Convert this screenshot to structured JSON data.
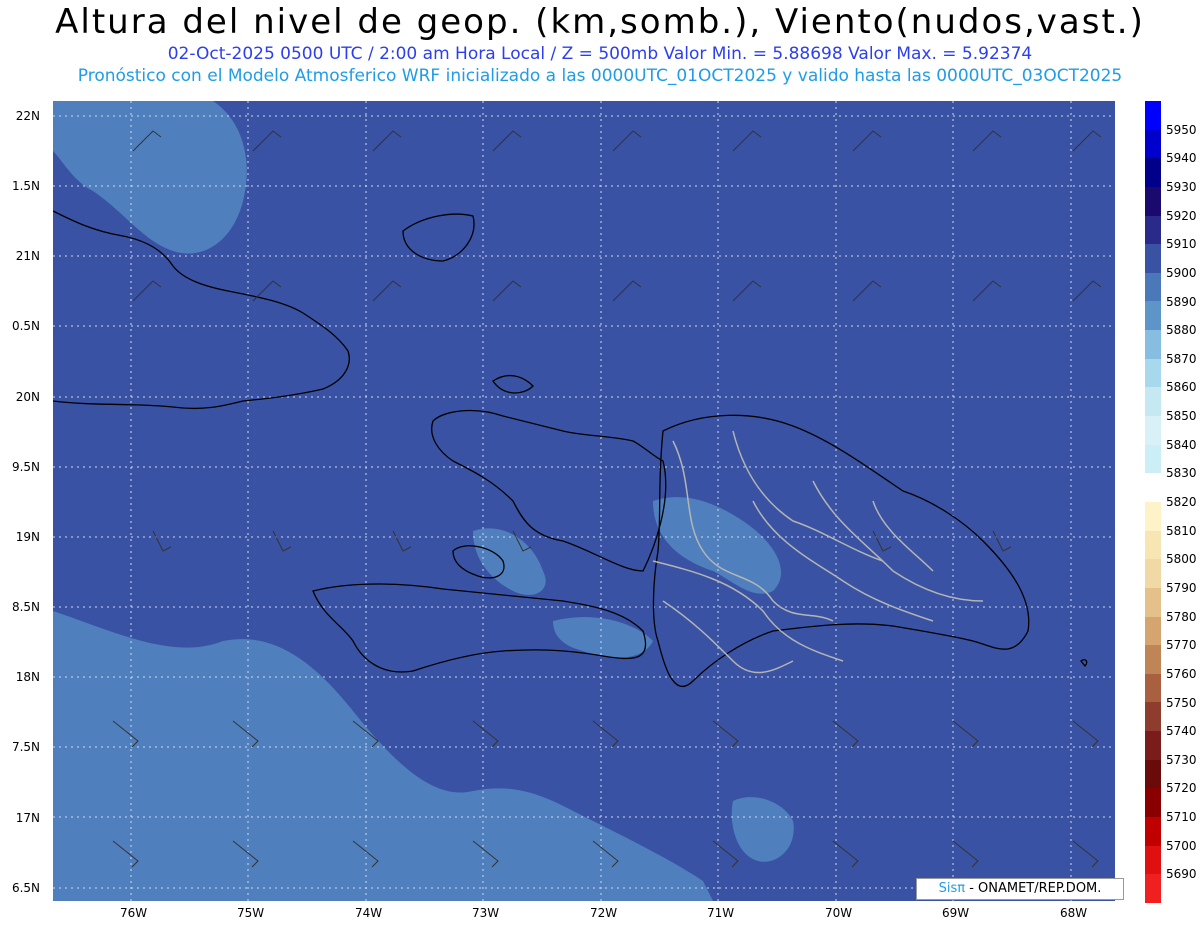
{
  "header": {
    "title": "Altura del nivel de geop. (km,somb.), Viento(nudos,vast.)",
    "subtitle": "02-Oct-2025   0500 UTC / 2:00 am Hora Local / Z = 500mb      Valor Min. = 5.88698   Valor Max. = 5.92374",
    "model_line": "Pronóstico con el Modelo Atmosferico WRF inicializado a las 0000UTC_01OCT2025 y valido hasta las  0000UTC_03OCT2025"
  },
  "axes": {
    "lat_labels": [
      "22N",
      "1.5N",
      "21N",
      "0.5N",
      "20N",
      "9.5N",
      "19N",
      "8.5N",
      "18N",
      "7.5N",
      "17N",
      "6.5N"
    ],
    "lon_labels": [
      "76W",
      "75W",
      "74W",
      "73W",
      "72W",
      "71W",
      "70W",
      "69W",
      "68W"
    ]
  },
  "colorbar": {
    "labels": [
      "5950",
      "5940",
      "5930",
      "5920",
      "5910",
      "5900",
      "5890",
      "5880",
      "5870",
      "5860",
      "5850",
      "5840",
      "5830",
      "5820",
      "5810",
      "5800",
      "5790",
      "5780",
      "5770",
      "5760",
      "5750",
      "5740",
      "5730",
      "5720",
      "5710",
      "5700",
      "5690"
    ],
    "colors": [
      "#0000ff",
      "#0000cc",
      "#00008b",
      "#1a0a6e",
      "#2a2a8a",
      "#3a52a4",
      "#4a78b8",
      "#5d95c8",
      "#86bde0",
      "#a8d8ec",
      "#c5e8f2",
      "#d8f0f6",
      "#cceff7",
      "#ffffff",
      "#fdf2c8",
      "#f7e6b4",
      "#f0d9a4",
      "#e4c08a",
      "#d4a56f",
      "#c08556",
      "#a86040",
      "#8e3c2e",
      "#7a1c1c",
      "#6a0a0a",
      "#8a0000",
      "#c00000",
      "#e01010",
      "#f02020"
    ]
  },
  "credit": {
    "brand": "Sisπ",
    "text": "- ONAMET/REP.DOM."
  },
  "colors": {
    "map_base": "#3a52a4",
    "light_field": "#4f80bd",
    "lighter_field": "#5d95c8",
    "title_blue": "#2b3ff0",
    "model_blue": "#1e9ce8"
  }
}
